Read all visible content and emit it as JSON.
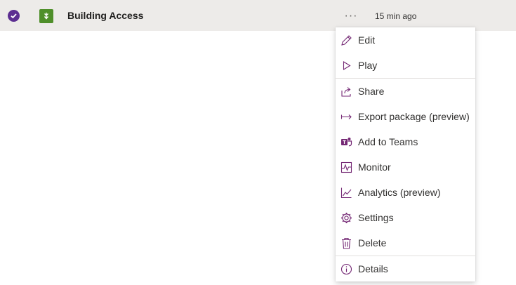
{
  "app_row": {
    "name": "Building Access",
    "more_label": "···",
    "modified": "15 min ago"
  },
  "context_menu": {
    "items": [
      {
        "label": "Edit",
        "icon": "pencil-icon"
      },
      {
        "label": "Play",
        "icon": "play-icon"
      },
      {
        "label": "Share",
        "icon": "share-icon"
      },
      {
        "label": "Export package (preview)",
        "icon": "export-arrow-icon"
      },
      {
        "label": "Add to Teams",
        "icon": "teams-icon"
      },
      {
        "label": "Monitor",
        "icon": "monitor-icon"
      },
      {
        "label": "Analytics (preview)",
        "icon": "analytics-icon"
      },
      {
        "label": "Settings",
        "icon": "gear-icon"
      },
      {
        "label": "Delete",
        "icon": "trash-icon"
      },
      {
        "label": "Details",
        "icon": "info-icon"
      }
    ]
  },
  "colors": {
    "accent": "#742774",
    "row_background": "#edebe9",
    "check_fill": "#5c2e91",
    "app_icon": "#4f8f2a"
  }
}
